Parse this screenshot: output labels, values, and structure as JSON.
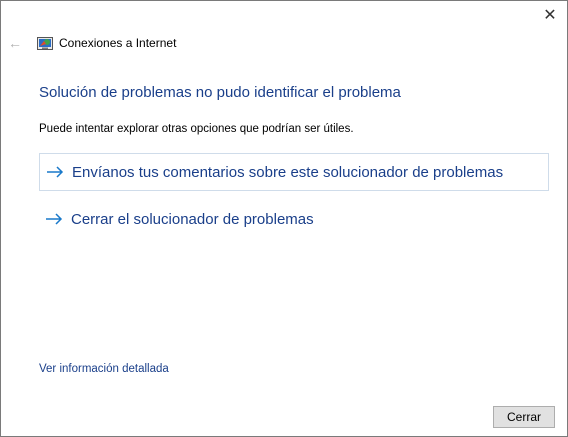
{
  "window": {
    "close_glyph": "✕",
    "back_glyph": "←",
    "title": "Conexiones a Internet"
  },
  "main": {
    "heading": "Solución de problemas no pudo identificar el problema",
    "description": "Puede intentar explorar otras opciones que podrían ser útiles.",
    "options": [
      {
        "label": "Envíanos tus comentarios sobre este solucionador de problemas",
        "icon": "arrow-right-icon"
      },
      {
        "label": "Cerrar el solucionador de problemas",
        "icon": "arrow-right-icon"
      }
    ],
    "details_link": "Ver información detallada"
  },
  "footer": {
    "close_button": "Cerrar"
  },
  "colors": {
    "link": "#1a3f8a",
    "arrow": "#1979ca"
  }
}
